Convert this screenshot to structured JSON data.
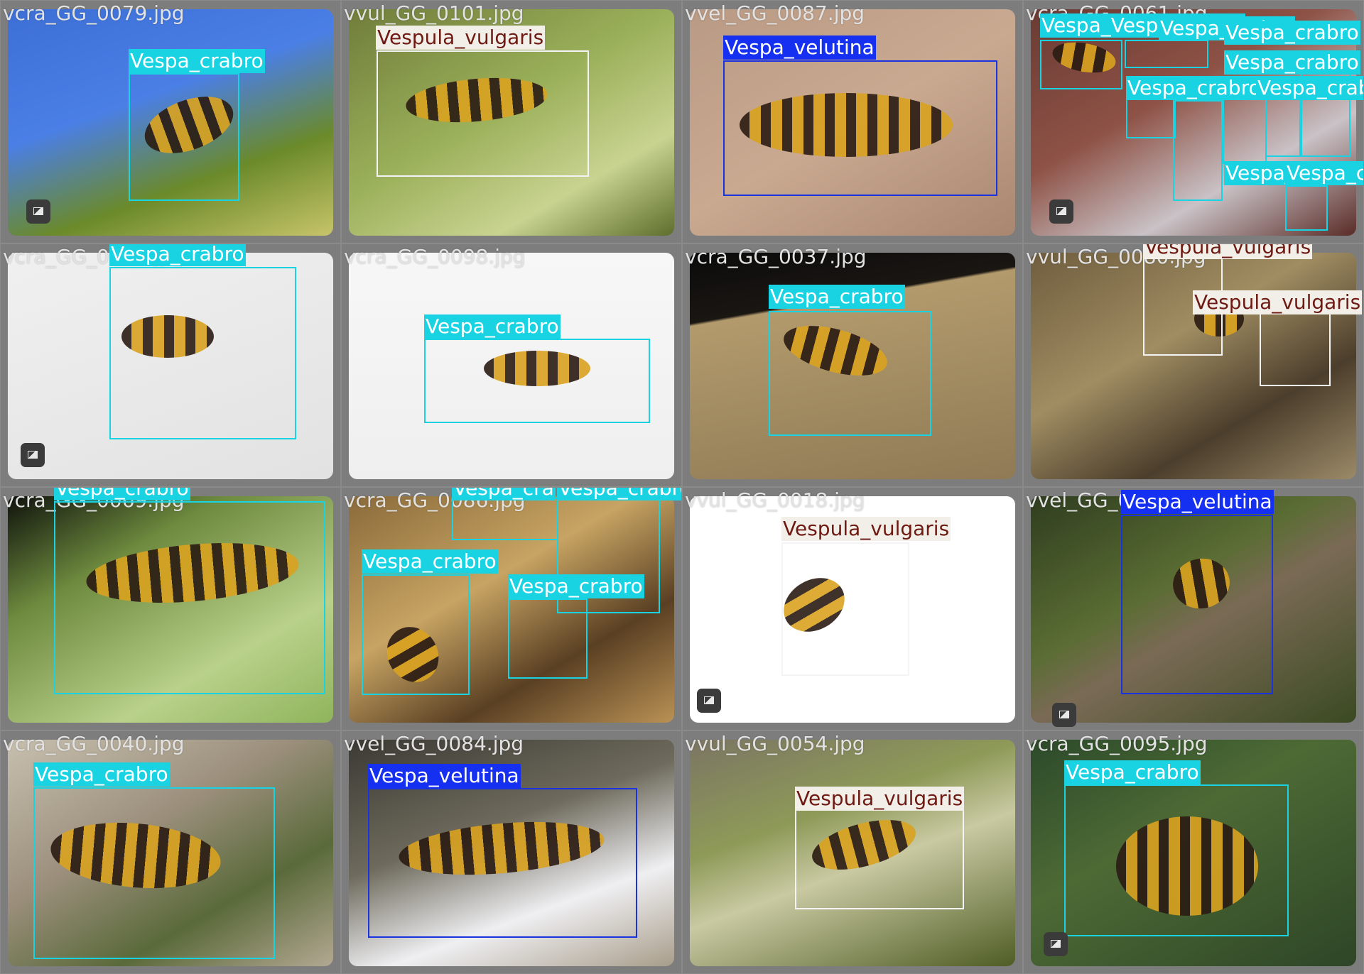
{
  "tiles": [
    {
      "filename": "vcra_GG_0079.jpg",
      "photo_bg": "linear-gradient(160deg,#3d6fd6 0%,#4a7fe6 40%,#6b8a2a 70%,#c7c46a 100%)",
      "icon": true,
      "detections": [
        {
          "label": "Vespa_crabro",
          "cls": "crabro"
        }
      ]
    },
    {
      "filename": "vvul_GG_0101.jpg",
      "photo_bg": "linear-gradient(150deg,#6f7d3a 0%,#9bb05a 45%,#c8d390 75%,#5e6e2c 100%)",
      "icon": false,
      "detections": [
        {
          "label": "Vespula_vulgaris",
          "cls": "vulgaris"
        }
      ]
    },
    {
      "filename": "vvel_GG_0087.jpg",
      "photo_bg": "linear-gradient(150deg,#b99a84 0%,#caa991 50%,#a88670 100%)",
      "icon": false,
      "detections": [
        {
          "label": "Vespa_velutina",
          "cls": "velutina"
        }
      ]
    },
    {
      "filename": "vcra_GG_0061.jpg",
      "photo_bg": "linear-gradient(150deg,#6a3b33 0%,#8e5246 40%,#c9c2c6 70%,#5a2c27 100%)",
      "icon": true,
      "detections": [
        {
          "label": "Vespa_Vespa_crabro",
          "cls": "crabro"
        },
        {
          "label": "Vespa_crabro",
          "cls": "crabro"
        },
        {
          "label": "Vespa_crabro",
          "cls": "crabro"
        },
        {
          "label": "Vespa_crabro",
          "cls": "crabro"
        },
        {
          "label": "Vespa_crabro",
          "cls": "crabro"
        },
        {
          "label": "Vespa_crabro",
          "cls": "crabro"
        },
        {
          "label": "Vespa_crabro",
          "cls": "crabro"
        },
        {
          "label": "Vespa_crabro",
          "cls": "crabro"
        }
      ]
    },
    {
      "filename": "vcra_GG_0021.jpg",
      "photo_bg": "linear-gradient(160deg,#f0f0f0 0%,#e2e2e2 100%)",
      "icon": true,
      "detections": [
        {
          "label": "Vespa_crabro",
          "cls": "crabro"
        }
      ]
    },
    {
      "filename": "vcra_GG_0098.jpg",
      "photo_bg": "linear-gradient(180deg,#f7f7f7 0%,#efefef 100%)",
      "icon": false,
      "detections": [
        {
          "label": "Vespa_crabro",
          "cls": "crabro"
        }
      ]
    },
    {
      "filename": "vcra_GG_0037.jpg",
      "photo_bg": "linear-gradient(170deg,#0b0b0b 0%,#1a1612 25%,#b29a6c 26%,#8f7a55 100%)",
      "icon": false,
      "detections": [
        {
          "label": "Vespa_crabro",
          "cls": "crabro"
        }
      ]
    },
    {
      "filename": "vvul_GG_0080.jpg",
      "photo_bg": "linear-gradient(150deg,#6f5d3e 0%,#a08d62 40%,#4c3e2c 70%,#9b8a68 100%)",
      "icon": false,
      "detections": [
        {
          "label": "Vespula_vulgaris",
          "cls": "vulgaris"
        },
        {
          "label": "Vespula_vulgaris",
          "cls": "vulgaris"
        }
      ]
    },
    {
      "filename": "vcra_GG_0069.jpg",
      "photo_bg": "linear-gradient(150deg,#0f120c 0%,#6d8a3e 30%,#b9d18a 70%,#8fb45c 100%)",
      "icon": false,
      "detections": [
        {
          "label": "Vespa_crabro",
          "cls": "crabro"
        }
      ]
    },
    {
      "filename": "vcra_GG_0086.jpg",
      "photo_bg": "linear-gradient(150deg,#8a6a3a 0%,#c7a463 40%,#5a4023 70%,#b99154 100%)",
      "icon": false,
      "detections": [
        {
          "label": "Vespa_cra",
          "cls": "crabro"
        },
        {
          "label": "Vespa_crabro",
          "cls": "crabro"
        },
        {
          "label": "Vespa_crabro",
          "cls": "crabro"
        },
        {
          "label": "Vespa_crabro",
          "cls": "crabro"
        }
      ]
    },
    {
      "filename": "vvul_GG_0018.jpg",
      "photo_bg": "linear-gradient(180deg,#ffffff 0%,#ffffff 100%)",
      "icon": true,
      "detections": [
        {
          "label": "Vespula_vulgaris",
          "cls": "vulgaris"
        }
      ]
    },
    {
      "filename": "vvel_GG_0072.jpg",
      "photo_bg": "linear-gradient(150deg,#2f3d1f 0%,#5a6d33 40%,#7a6a55 55%,#3a4a22 100%)",
      "icon": true,
      "detections": [
        {
          "label": "Vespa_velutina",
          "cls": "velutina"
        }
      ]
    },
    {
      "filename": "vcra_GG_0040.jpg",
      "photo_bg": "linear-gradient(150deg,#c7bfae 0%,#9b8f7c 40%,#5a6a3a 70%,#b3a892 100%)",
      "icon": false,
      "detections": [
        {
          "label": "Vespa_crabro",
          "cls": "crabro"
        }
      ]
    },
    {
      "filename": "vvel_GG_0084.jpg",
      "photo_bg": "linear-gradient(160deg,#3b3a34 0%,#6e6a5c 40%,#efeff2 70%,#a89d8a 100%)",
      "icon": false,
      "detections": [
        {
          "label": "Vespa_velutina",
          "cls": "velutina"
        }
      ]
    },
    {
      "filename": "vvul_GG_0054.jpg",
      "photo_bg": "linear-gradient(160deg,#7b7563 0%,#8e9a58 35%,#c9c9a2 55%,#4f5d25 100%)",
      "icon": false,
      "detections": [
        {
          "label": "Vespula_vulgaris",
          "cls": "vulgaris"
        }
      ]
    },
    {
      "filename": "vcra_GG_0095.jpg",
      "photo_bg": "linear-gradient(150deg,#2c4a2a 0%,#4d6a35 40%,#2e4527 100%)",
      "icon": true,
      "detections": [
        {
          "label": "Vespa_crabro",
          "cls": "crabro"
        }
      ]
    }
  ]
}
